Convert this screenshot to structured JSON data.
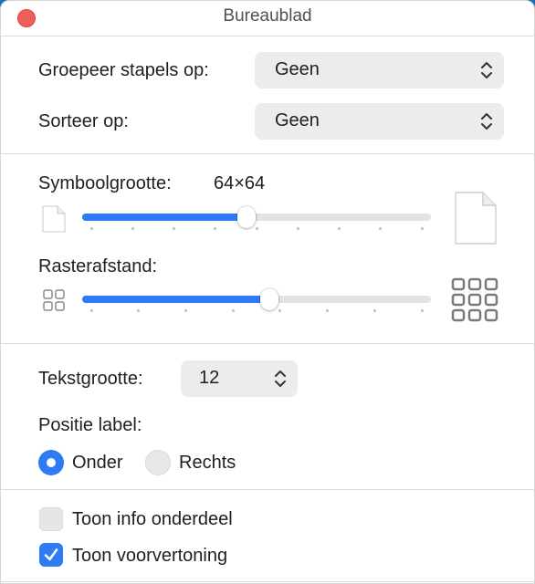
{
  "window": {
    "title": "Bureaublad"
  },
  "group_by": {
    "label": "Groepeer stapels op:",
    "value": "Geen"
  },
  "sort_by": {
    "label": "Sorteer op:",
    "value": "Geen"
  },
  "icon_size": {
    "label": "Symboolgrootte:",
    "value": "64×64",
    "level": 0.47
  },
  "grid_spacing": {
    "label": "Rasterafstand:",
    "level": 0.54
  },
  "text_size": {
    "label": "Tekstgrootte:",
    "value": "12"
  },
  "label_position": {
    "label": "Positie label:",
    "options": [
      {
        "label": "Onder",
        "selected": true
      },
      {
        "label": "Rechts",
        "selected": false
      }
    ]
  },
  "checkboxes": [
    {
      "label": "Toon info onderdeel",
      "checked": false
    },
    {
      "label": "Toon voorvertoning",
      "checked": true
    }
  ],
  "colors": {
    "accent": "#2f7af5",
    "close_button": "#ee5f5a"
  },
  "icons": {
    "small_file": "small-document-icon",
    "large_file": "large-document-icon",
    "small_grid": "small-grid-icon",
    "large_grid": "large-grid-icon",
    "popup_arrows": "up-down-chevron-icon",
    "check": "checkmark-icon"
  }
}
